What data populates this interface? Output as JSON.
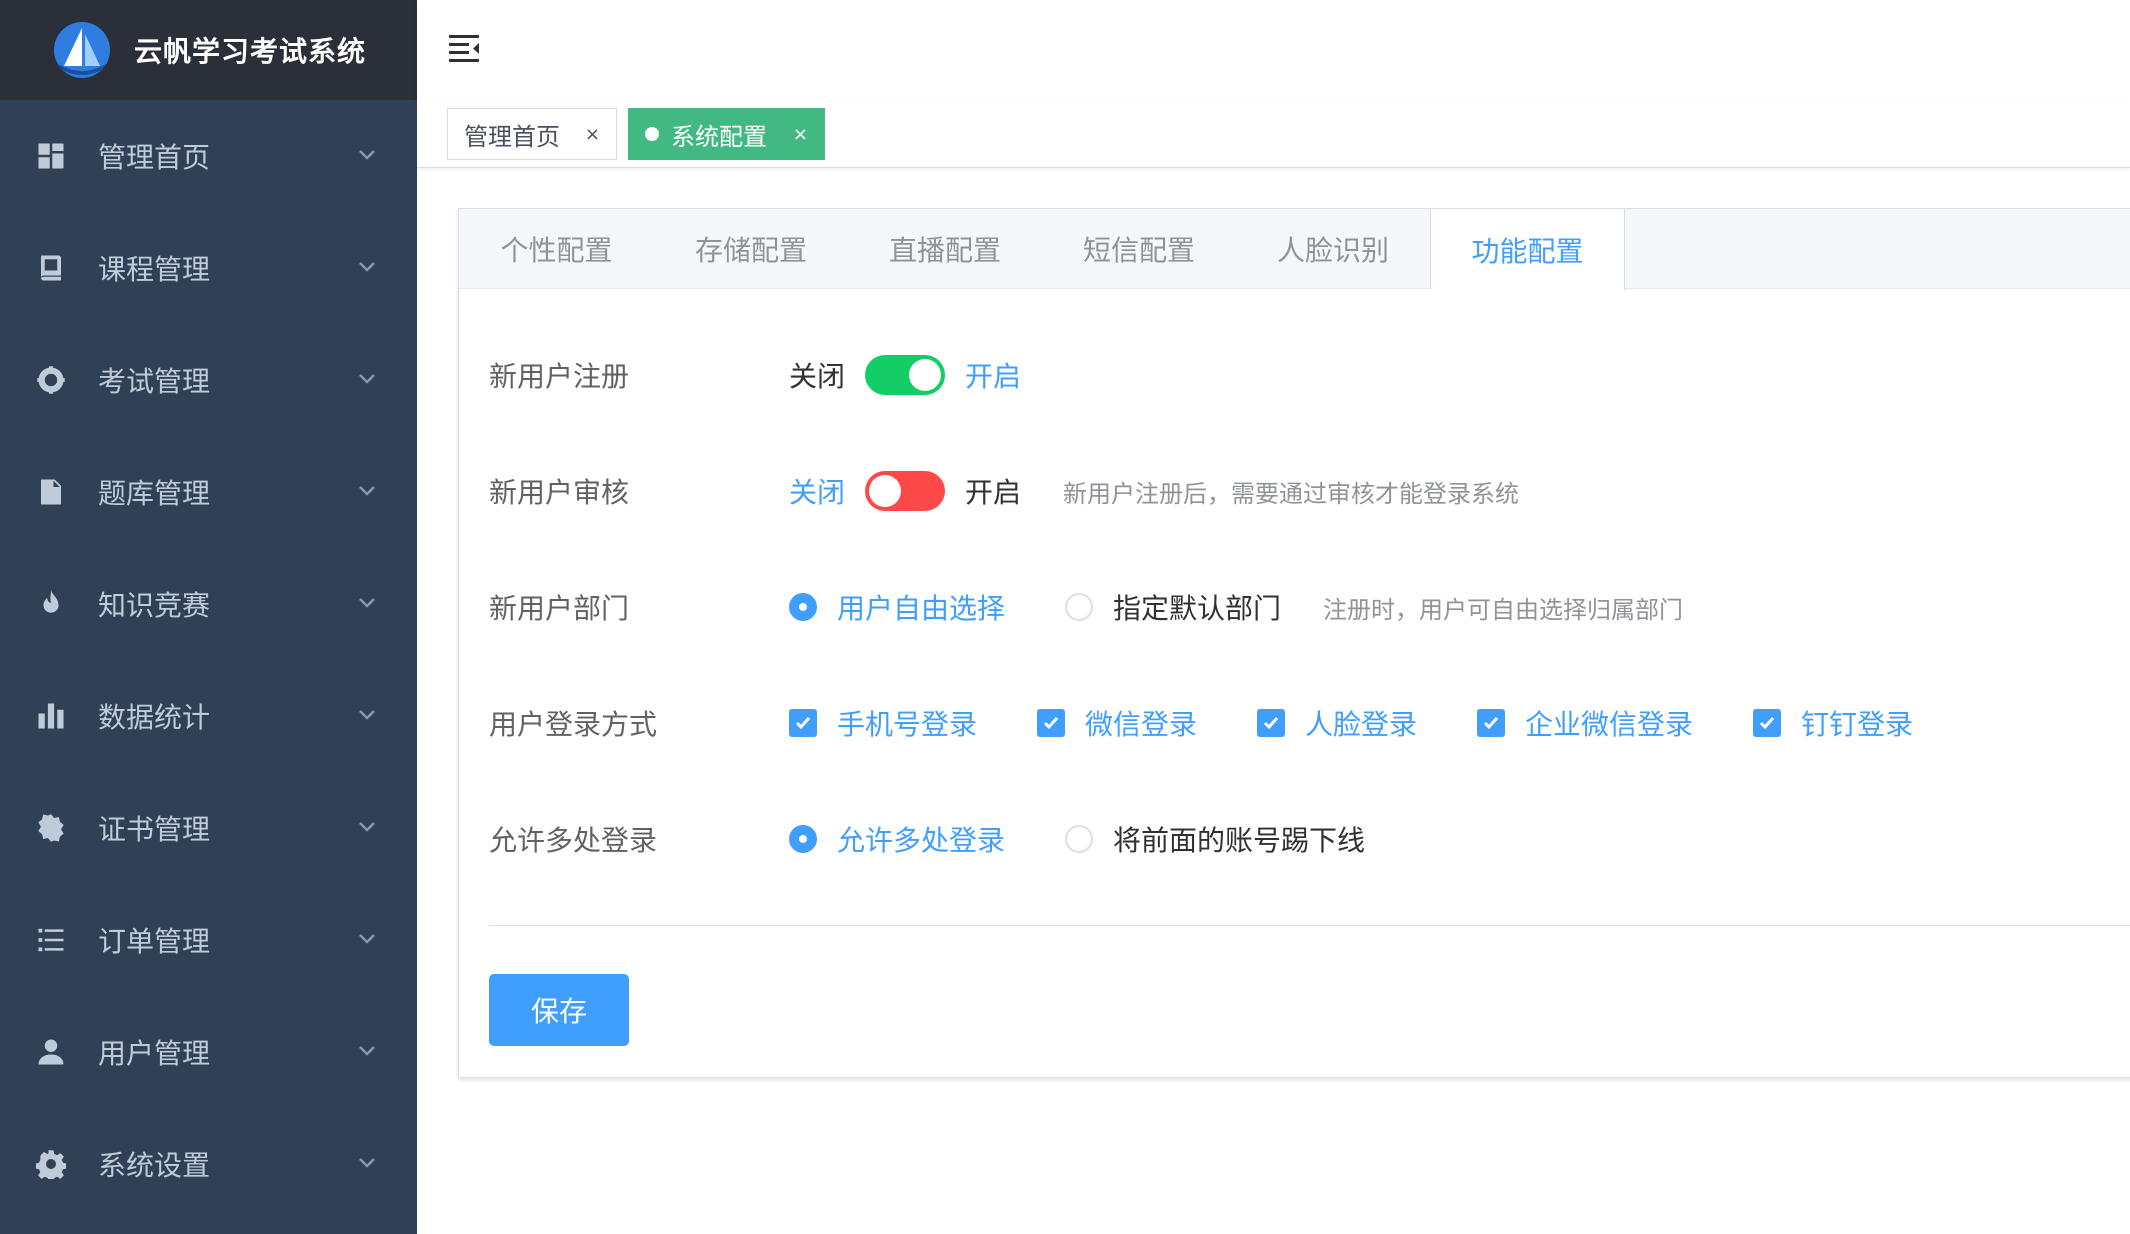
{
  "app": {
    "title": "云帆学习考试系统"
  },
  "sidebar": {
    "items": [
      {
        "label": "管理首页",
        "icon": "dashboard-icon"
      },
      {
        "label": "课程管理",
        "icon": "book-icon"
      },
      {
        "label": "考试管理",
        "icon": "exam-icon"
      },
      {
        "label": "题库管理",
        "icon": "document-icon"
      },
      {
        "label": "知识竞赛",
        "icon": "fire-icon"
      },
      {
        "label": "数据统计",
        "icon": "bar-chart-icon"
      },
      {
        "label": "证书管理",
        "icon": "certificate-icon"
      },
      {
        "label": "订单管理",
        "icon": "list-icon"
      },
      {
        "label": "用户管理",
        "icon": "user-icon"
      },
      {
        "label": "系统设置",
        "icon": "gear-icon"
      }
    ]
  },
  "tags": {
    "home": "管理首页",
    "active": "系统配置",
    "close_glyph": "×"
  },
  "tabs": [
    {
      "label": "个性配置",
      "active": false
    },
    {
      "label": "存储配置",
      "active": false
    },
    {
      "label": "直播配置",
      "active": false
    },
    {
      "label": "短信配置",
      "active": false
    },
    {
      "label": "人脸识别",
      "active": false
    },
    {
      "label": "功能配置",
      "active": true
    }
  ],
  "form": {
    "register": {
      "label": "新用户注册",
      "off": "关闭",
      "on": "开启",
      "enabled": true
    },
    "audit": {
      "label": "新用户审核",
      "off": "关闭",
      "on": "开启",
      "enabled": false,
      "hint": "新用户注册后，需要通过审核才能登录系统"
    },
    "department": {
      "label": "新用户部门",
      "options": [
        "用户自由选择",
        "指定默认部门"
      ],
      "selected": 0,
      "hint": "注册时，用户可自由选择归属部门"
    },
    "login": {
      "label": "用户登录方式",
      "options": [
        "手机号登录",
        "微信登录",
        "人脸登录",
        "企业微信登录",
        "钉钉登录"
      ],
      "checked": [
        true,
        true,
        true,
        true,
        true
      ]
    },
    "multi": {
      "label": "允许多处登录",
      "options": [
        "允许多处登录",
        "将前面的账号踢下线"
      ],
      "selected": 0
    },
    "save_label": "保存"
  },
  "colors": {
    "primary": "#409eff",
    "sidebar": "#304156",
    "switch_on": "#13ce66",
    "switch_off": "#ff4949",
    "tag_active": "#42b983"
  }
}
